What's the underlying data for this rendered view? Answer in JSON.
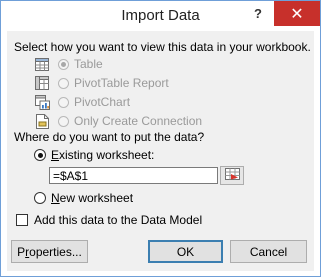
{
  "dialog": {
    "title": "Import Data",
    "help_glyph": "?",
    "close_glyph": "✕"
  },
  "view_section": {
    "label": "Select how you want to view this data in your workbook.",
    "options": [
      {
        "label": "Table",
        "icon": "table-icon",
        "selected": true,
        "enabled": false
      },
      {
        "label": "PivotTable Report",
        "icon": "pivottable-icon",
        "selected": false,
        "enabled": false
      },
      {
        "label": "PivotChart",
        "icon": "pivotchart-icon",
        "selected": false,
        "enabled": false
      },
      {
        "label": "Only Create Connection",
        "icon": "connection-only-icon",
        "selected": false,
        "enabled": false
      }
    ]
  },
  "location_section": {
    "label": "Where do you want to put the data?",
    "existing_prefix": "E",
    "existing_rest": "xisting worksheet:",
    "existing_selected": true,
    "reference_value": "=$A$1",
    "collapse_icon": "range-select-icon",
    "new_prefix": "N",
    "new_rest": "ew worksheet",
    "new_selected": false
  },
  "data_model": {
    "label": "Add this data to the Data Model",
    "checked": false
  },
  "buttons": {
    "properties_prefix": "P",
    "properties_u": "r",
    "properties_rest": "operties...",
    "ok": "OK",
    "cancel": "Cancel"
  },
  "colors": {
    "close_button": "#c7302b",
    "window_border": "#6f9fd8",
    "client_background": "#f0f0f0",
    "disabled_text": "#9a9a9a"
  }
}
